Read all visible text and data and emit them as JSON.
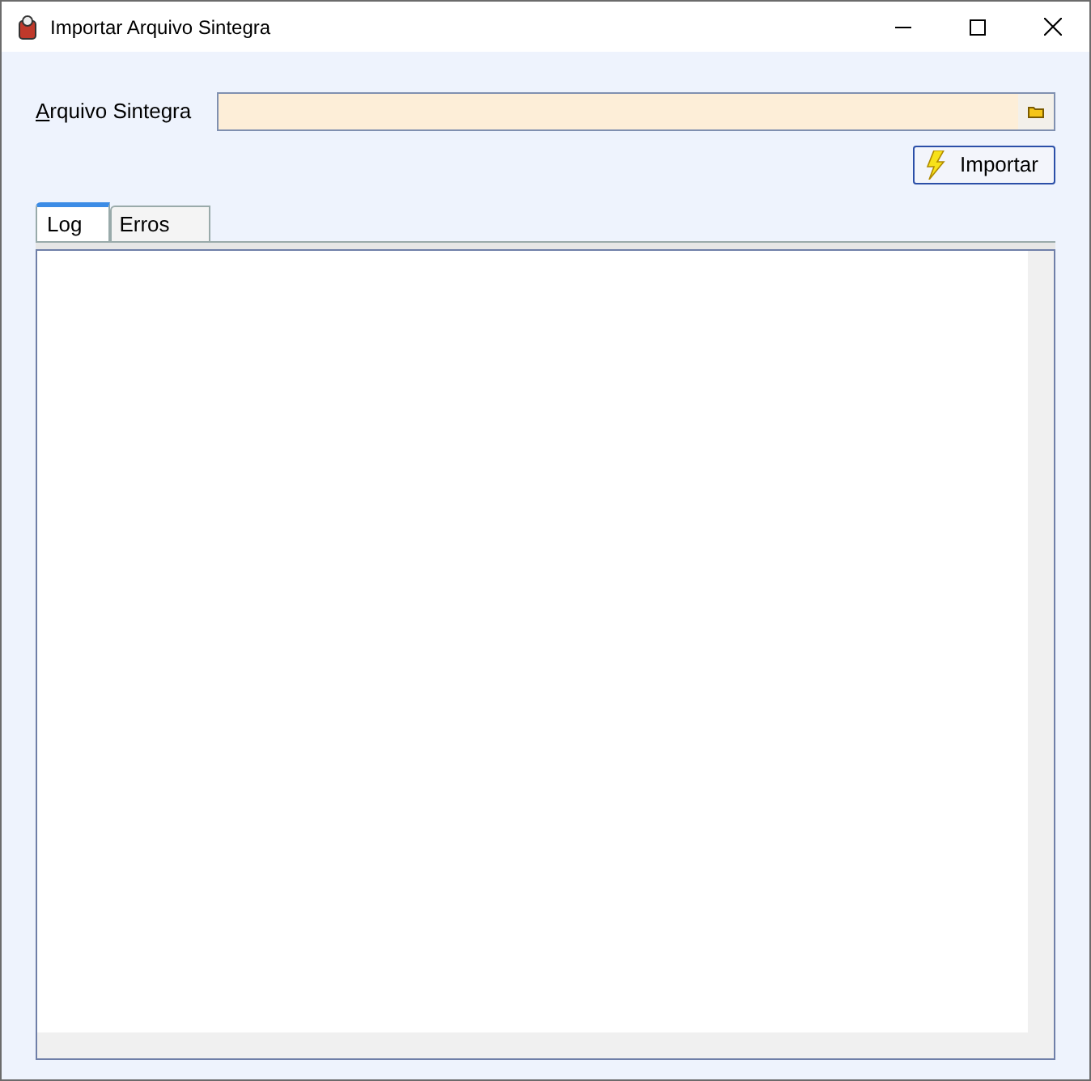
{
  "window": {
    "title": "Importar Arquivo Sintegra"
  },
  "file_field": {
    "label": "Arquivo Sintegra"
  },
  "import_button": {
    "label": "Importar"
  },
  "tabs": [
    {
      "label": "Log",
      "selected": true
    },
    {
      "label": "Erros",
      "selected": false
    }
  ]
}
